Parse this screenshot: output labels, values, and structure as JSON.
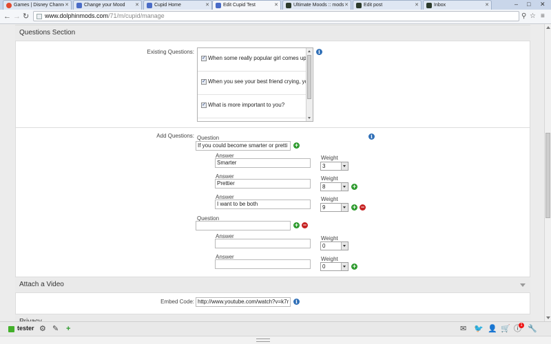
{
  "browser": {
    "tabs": [
      {
        "label": "Games | Disney Channel",
        "color": "#e24a2f"
      },
      {
        "label": "Change your Mood",
        "color": "#4a6cc7"
      },
      {
        "label": "Cupid Home",
        "color": "#4a6cc7"
      },
      {
        "label": "Edit Cupid Test",
        "color": "#4a6cc7"
      },
      {
        "label": "Ultimate Moods :: mods",
        "color": "#2b3a2b"
      },
      {
        "label": "Edit post",
        "color": "#2b3a2b"
      },
      {
        "label": "Inbox",
        "color": "#2b3a2b"
      }
    ],
    "active_tab": 3,
    "url_domain": "www.dolphinmods.com",
    "url_path": "/71/m/cupid/manage"
  },
  "questions_section": {
    "title": "Questions Section",
    "existing_label": "Existing Questions:",
    "existing": [
      "When some really popular girl comes up",
      "When you see your best friend crying, yo",
      "What is more important to you?"
    ]
  },
  "add_questions": {
    "label": "Add Questions:",
    "question_label": "Question",
    "answer_label": "Answer",
    "weight_label": "Weight",
    "questions": [
      {
        "text": "If you could become smarter or pretti",
        "answers": [
          {
            "text": "Smarter",
            "weight": "3"
          },
          {
            "text": "Prettier",
            "weight": "8"
          },
          {
            "text": "I want to be both",
            "weight": "9"
          }
        ]
      },
      {
        "text": "",
        "answers": [
          {
            "text": "",
            "weight": "0"
          },
          {
            "text": "",
            "weight": "0"
          }
        ]
      }
    ]
  },
  "video": {
    "title": "Attach a Video",
    "embed_label": "Embed Code:",
    "embed_value": "http://www.youtube.com/watch?v=k7r"
  },
  "privacy": {
    "title": "Privacy"
  },
  "bottom_bar": {
    "username": "tester",
    "notification_count": "1"
  },
  "colors": {
    "add": "#2d9a2d",
    "remove": "#c62222",
    "info": "#2f6fb7",
    "user_status": "#43b02a"
  }
}
